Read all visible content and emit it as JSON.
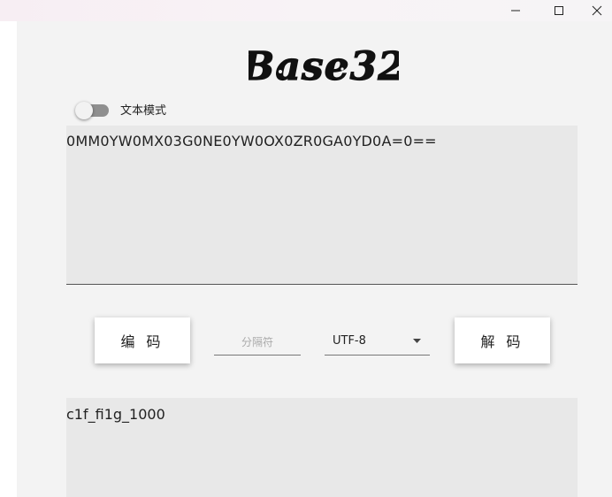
{
  "app": {
    "logo_text": "Base32"
  },
  "mode": {
    "text_mode_label": "文本模式",
    "text_mode_on": false
  },
  "input": {
    "value": "0MM0YW0MX03G0NE0YW0OX0ZR0GA0YD0A=0=="
  },
  "controls": {
    "encode_label": "编 码",
    "separator_placeholder": "分隔符",
    "charset_selected": "UTF-8",
    "decode_label": "解 码"
  },
  "output": {
    "value": "c1f_fi1g_1000"
  },
  "icons": {
    "minimize": "minimize-icon",
    "maximize": "maximize-icon",
    "close": "close-icon",
    "dropdown": "caret-down-icon"
  },
  "colors": {
    "background": "#f3f3f3",
    "field_background": "#e8e8e8",
    "text": "#222222"
  }
}
